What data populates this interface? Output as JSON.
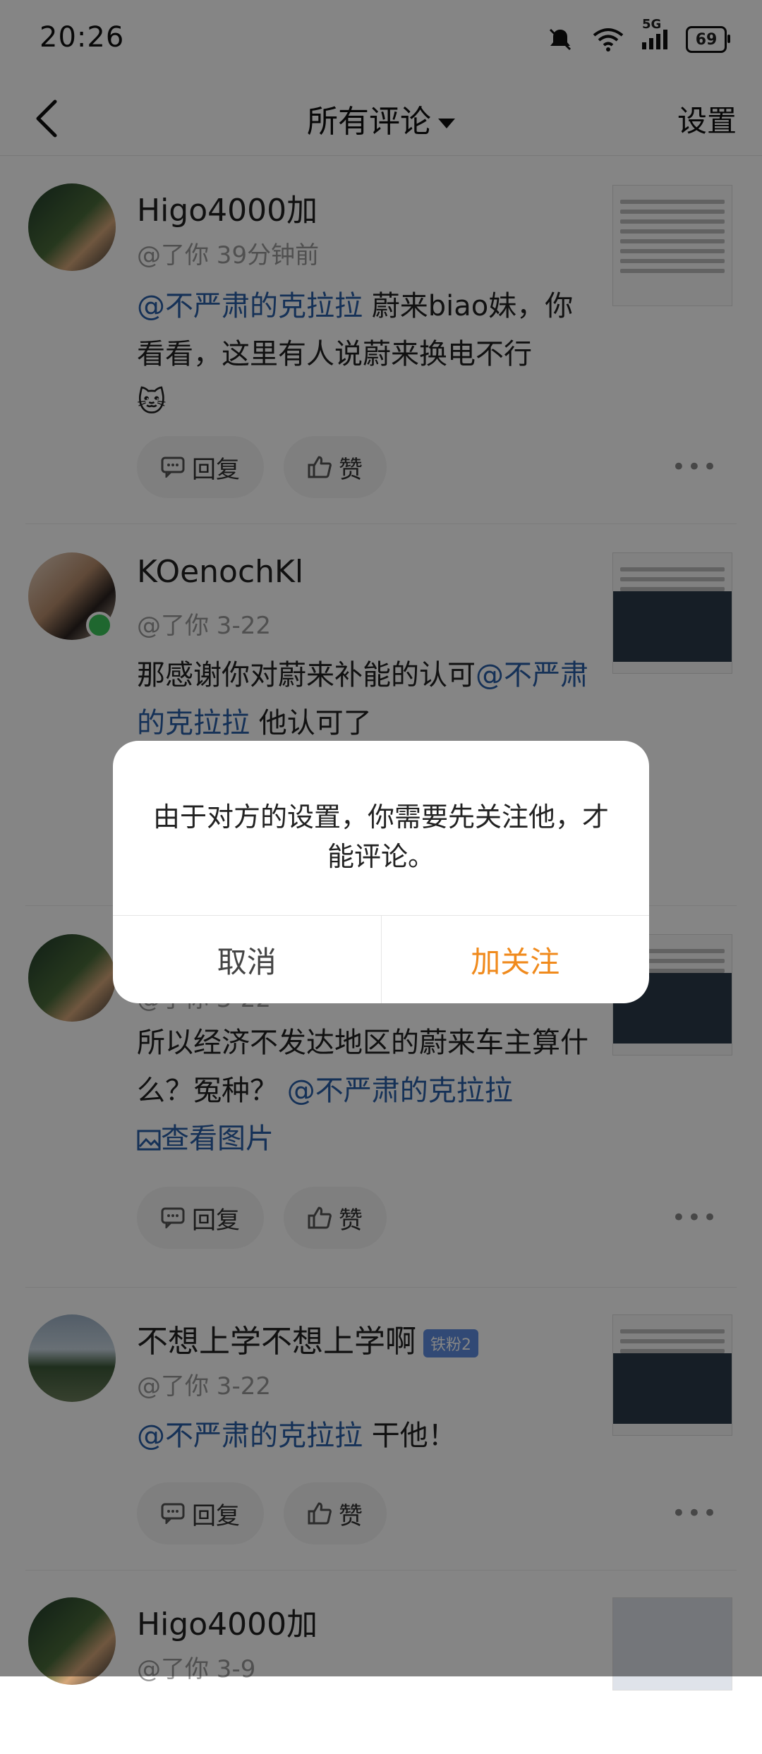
{
  "status": {
    "time": "20:26",
    "network": "5G",
    "battery": "69"
  },
  "nav": {
    "title": "所有评论",
    "settings": "设置"
  },
  "actions": {
    "reply": "回复",
    "like": "赞"
  },
  "comments": [
    {
      "name": "Higo4000加",
      "meta": "@了你  39分钟前",
      "mention": "@不严肃的克拉拉",
      "text": " 蔚来biao妹，你看看，这里有人说蔚来换电不行",
      "emoji": "🐱"
    },
    {
      "name": "KOenochKl",
      "meta": "@了你  3-22",
      "text_before": "那感谢你对蔚来补能的认可",
      "mention": "@不严肃的克拉拉",
      "text_after": " 他认可了"
    },
    {
      "name": "",
      "meta": "@了你  3-22",
      "text": "所以经济不发达地区的蔚来车主算什么？冤种？",
      "mention": "@不严肃的克拉拉",
      "link": "查看图片"
    },
    {
      "name": "不想上学不想上学啊",
      "badge": "铁粉2",
      "meta": "@了你  3-22",
      "mention": "@不严肃的克拉拉",
      "text": " 干他！"
    },
    {
      "name": "Higo4000加",
      "meta": "@了你  3-9"
    }
  ],
  "dialog": {
    "message": "由于对方的设置，你需要先关注他，才能评论。",
    "cancel": "取消",
    "confirm": "加关注"
  },
  "colors": {
    "mention": "#2a5ea8",
    "confirm": "#f08a1c",
    "online": "#3cc55a",
    "overlay": "rgba(0,0,0,0.48)"
  },
  "icons": [
    "back-arrow-icon",
    "caret-down-icon",
    "mute-bell-icon",
    "wifi-icon",
    "signal-icon",
    "battery-icon",
    "comment-icon",
    "thumbs-up-icon",
    "more-dots-icon",
    "image-icon"
  ]
}
